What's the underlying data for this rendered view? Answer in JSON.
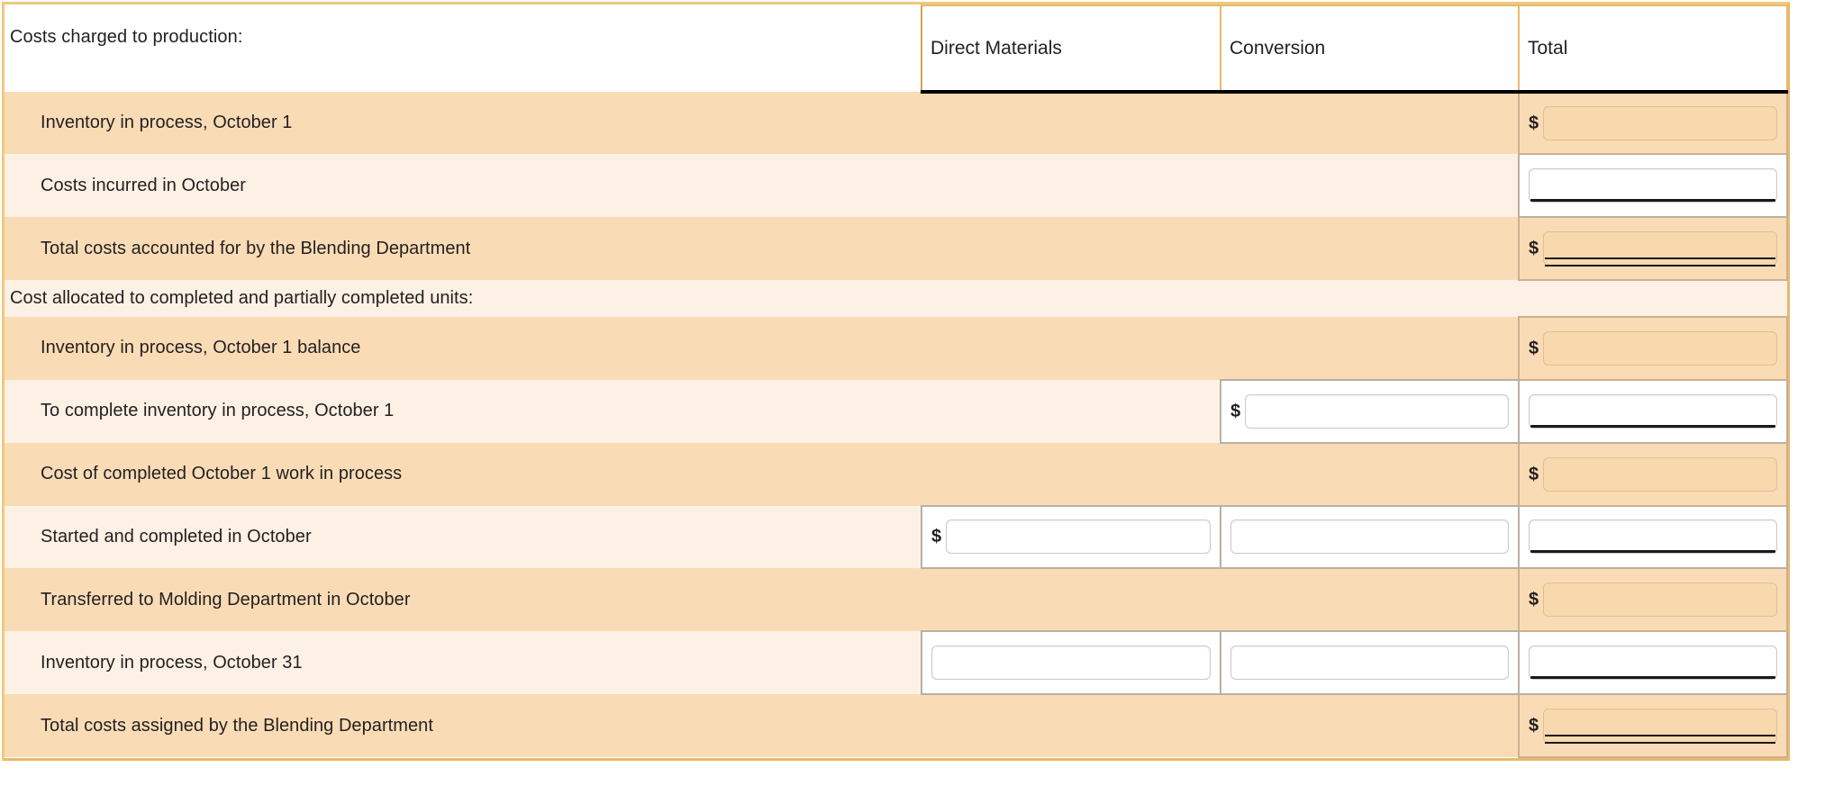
{
  "report": {
    "section_costs_charged": "Costs charged to production:",
    "section_cost_allocated": "Cost allocated to completed and partially completed units:",
    "currency_symbol": "$"
  },
  "columns": {
    "label_header": "",
    "direct_materials": "Direct Materials",
    "conversion": "Conversion",
    "total": "Total"
  },
  "rows": [
    {
      "label": "Inventory in process, October 1",
      "shade": "dark",
      "direct_materials": {
        "present": false,
        "value": ""
      },
      "conversion": {
        "present": false,
        "value": ""
      },
      "total": {
        "present": true,
        "value": "",
        "dollar": true,
        "state": "shaded",
        "underline": "none"
      }
    },
    {
      "label": "Costs incurred in October",
      "shade": "light",
      "direct_materials": {
        "present": false,
        "value": ""
      },
      "conversion": {
        "present": false,
        "value": ""
      },
      "total": {
        "present": true,
        "value": "",
        "dollar": false,
        "state": "editable",
        "underline": "single"
      }
    },
    {
      "label": "Total costs accounted for by the Blending Department",
      "shade": "dark",
      "direct_materials": {
        "present": false,
        "value": ""
      },
      "conversion": {
        "present": false,
        "value": ""
      },
      "total": {
        "present": true,
        "value": "",
        "dollar": true,
        "state": "shaded",
        "underline": "double"
      }
    },
    {
      "label": "Inventory in process, October 1 balance",
      "shade": "dark",
      "direct_materials": {
        "present": false,
        "value": ""
      },
      "conversion": {
        "present": false,
        "value": ""
      },
      "total": {
        "present": true,
        "value": "",
        "dollar": true,
        "state": "shaded",
        "underline": "none"
      }
    },
    {
      "label": "To complete inventory in process, October 1",
      "shade": "light",
      "direct_materials": {
        "present": false,
        "value": ""
      },
      "conversion": {
        "present": true,
        "value": "",
        "dollar": true,
        "state": "editable",
        "underline": "none"
      },
      "total": {
        "present": true,
        "value": "",
        "dollar": false,
        "state": "editable",
        "underline": "single"
      }
    },
    {
      "label": "Cost of completed October 1 work in process",
      "shade": "dark",
      "direct_materials": {
        "present": false,
        "value": ""
      },
      "conversion": {
        "present": false,
        "value": ""
      },
      "total": {
        "present": true,
        "value": "",
        "dollar": true,
        "state": "shaded",
        "underline": "none"
      }
    },
    {
      "label": "Started and completed in October",
      "shade": "light",
      "direct_materials": {
        "present": true,
        "value": "",
        "dollar": true,
        "state": "editable",
        "underline": "none"
      },
      "conversion": {
        "present": true,
        "value": "",
        "dollar": false,
        "state": "editable",
        "underline": "none"
      },
      "total": {
        "present": true,
        "value": "",
        "dollar": false,
        "state": "editable",
        "underline": "single"
      }
    },
    {
      "label": "Transferred to Molding Department in October",
      "shade": "dark",
      "direct_materials": {
        "present": false,
        "value": ""
      },
      "conversion": {
        "present": false,
        "value": ""
      },
      "total": {
        "present": true,
        "value": "",
        "dollar": true,
        "state": "shaded",
        "underline": "none"
      }
    },
    {
      "label": "Inventory in process, October 31",
      "shade": "light",
      "direct_materials": {
        "present": true,
        "value": "",
        "dollar": false,
        "state": "editable",
        "underline": "none"
      },
      "conversion": {
        "present": true,
        "value": "",
        "dollar": false,
        "state": "editable",
        "underline": "none"
      },
      "total": {
        "present": true,
        "value": "",
        "dollar": false,
        "state": "editable",
        "underline": "single"
      }
    },
    {
      "label": "Total costs assigned by the Blending Department",
      "shade": "dark",
      "direct_materials": {
        "present": false,
        "value": ""
      },
      "conversion": {
        "present": false,
        "value": ""
      },
      "total": {
        "present": true,
        "value": "",
        "dollar": true,
        "state": "shaded",
        "underline": "double"
      }
    }
  ],
  "section_row_index": 3,
  "colors": {
    "shade_dark": "#F9DCB6",
    "shade_light": "#FDF1E5",
    "table_border": "#E8B96A",
    "header_rule": "#000000",
    "text": "#231f20"
  }
}
